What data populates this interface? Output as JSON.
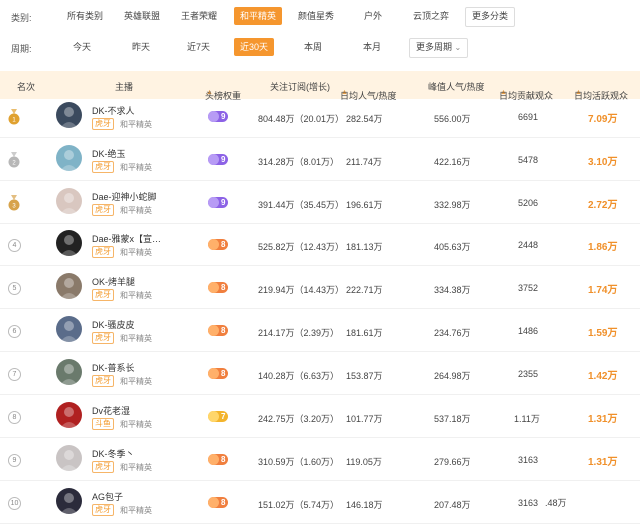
{
  "filters": {
    "category_label": "类别:",
    "categories": [
      "所有类别",
      "英雄联盟",
      "王者荣耀",
      "和平精英",
      "颜值星秀",
      "户外",
      "云顶之弈"
    ],
    "more_categories": "更多分类",
    "period_label": "周期:",
    "periods": [
      "今天",
      "昨天",
      "近7天",
      "近30天",
      "本周",
      "本月"
    ],
    "more_periods": "更多周期"
  },
  "table": {
    "headers": {
      "rank": "名次",
      "streamer": "主播",
      "weight": "头榜权重",
      "subs": "关注订阅(增长)",
      "daily_pop": "日均人气/热度",
      "peak_pop": "峰值人气/热度",
      "daily_gift": "日均贡献观众",
      "daily_active": "日均活跃观众"
    },
    "sort_arrow": "▲",
    "rows": [
      {
        "rank": "1",
        "name": "DK-不求人",
        "platform": "虎牙",
        "game": "和平精英",
        "weight": "9",
        "subs": "804.48万（20.01万）",
        "daily_pop": "282.54万",
        "peak_pop": "556.00万",
        "daily_gift": "6691",
        "daily_active": "7.09万"
      },
      {
        "rank": "2",
        "name": "DK-绝玉",
        "platform": "虎牙",
        "game": "和平精英",
        "weight": "9",
        "subs": "314.28万（8.01万）",
        "daily_pop": "211.74万",
        "peak_pop": "422.16万",
        "daily_gift": "5478",
        "daily_active": "3.10万"
      },
      {
        "rank": "3",
        "name": "Dae-迎神小蛇脚",
        "platform": "虎牙",
        "game": "和平精英",
        "weight": "9",
        "subs": "391.44万（35.45万）",
        "daily_pop": "196.61万",
        "peak_pop": "332.98万",
        "daily_gift": "5206",
        "daily_active": "2.72万"
      },
      {
        "rank": "4",
        "name": "Dae-雅蒙x【宣…",
        "platform": "虎牙",
        "game": "和平精英",
        "weight": "8",
        "subs": "525.82万（12.43万）",
        "daily_pop": "181.13万",
        "peak_pop": "405.63万",
        "daily_gift": "2448",
        "daily_active": "1.86万"
      },
      {
        "rank": "5",
        "name": "OK-烤羊腿",
        "platform": "虎牙",
        "game": "和平精英",
        "weight": "8",
        "subs": "219.94万（14.43万）",
        "daily_pop": "222.71万",
        "peak_pop": "334.38万",
        "daily_gift": "3752",
        "daily_active": "1.74万"
      },
      {
        "rank": "6",
        "name": "DK-骚皮皮",
        "platform": "虎牙",
        "game": "和平精英",
        "weight": "8",
        "subs": "214.17万（2.39万）",
        "daily_pop": "181.61万",
        "peak_pop": "234.76万",
        "daily_gift": "1486",
        "daily_active": "1.59万"
      },
      {
        "rank": "7",
        "name": "DK-普系长",
        "platform": "虎牙",
        "game": "和平精英",
        "weight": "8",
        "subs": "140.28万（6.63万）",
        "daily_pop": "153.87万",
        "peak_pop": "264.98万",
        "daily_gift": "2355",
        "daily_active": "1.42万"
      },
      {
        "rank": "8",
        "name": "Dv花老湿",
        "platform": "斗鱼",
        "game": "和平精英",
        "weight": "7",
        "subs": "242.75万（3.20万）",
        "daily_pop": "101.77万",
        "peak_pop": "537.18万",
        "daily_gift": "1.11万",
        "daily_active": "1.31万"
      },
      {
        "rank": "9",
        "name": "DK-冬季丶",
        "platform": "虎牙",
        "game": "和平精英",
        "weight": "8",
        "subs": "310.59万（1.60万）",
        "daily_pop": "119.05万",
        "peak_pop": "279.66万",
        "daily_gift": "3163",
        "daily_active": "1.31万"
      },
      {
        "rank": "10",
        "name": "AG包子",
        "platform": "虎牙",
        "game": "和平精英",
        "weight": "8",
        "subs": "151.02万（5.74万）",
        "daily_pop": "146.18万",
        "peak_pop": "207.48万",
        "daily_gift": "3163",
        "daily_active": ".48万"
      }
    ]
  },
  "colors": {
    "accent": "#f5962e",
    "header_bg": "#fff3e2",
    "highlight_value": "#f0902a"
  }
}
